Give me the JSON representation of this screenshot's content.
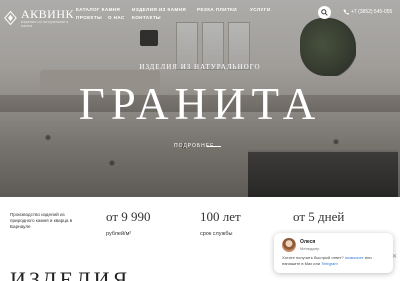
{
  "header": {
    "logo_text": "АКВИНК",
    "logo_sub": "изделия из натурального камня",
    "nav": [
      "КАТАЛОГ КАМНЯ",
      "ИЗДЕЛИЯ ИЗ КАМНЯ",
      "РЕЗКА ПЛИТКИ",
      "УСЛУГИ",
      "ПРОЕКТЫ",
      "О НАС",
      "КОНТАКТЫ"
    ],
    "phone": "+7 (3852) 545-055",
    "icons": {
      "search": "search-icon",
      "phone": "phone-icon",
      "logo": "logo-mark-icon"
    }
  },
  "hero": {
    "subtitle": "ИЗДЕЛИЯ ИЗ НАТУРАЛЬНОГО",
    "title": "ГРАНИТА",
    "more": "ПОДРОБНЕЕ"
  },
  "intro": "Производство изделий из природного камня и кварца в Барнауле",
  "stats": [
    {
      "value": "от 9 990",
      "label": "рублей/м²"
    },
    {
      "value": "100 лет",
      "label": "срок службы"
    },
    {
      "value": "от 5 дней",
      "label": "срок изготовления"
    }
  ],
  "section_heading": "ИЗДЕЛИЯ",
  "chat": {
    "name": "Олеся",
    "role": "Менеджер",
    "message_start": "Хотите получить быстрый ответ?",
    "link1": "позвоните",
    "message_mid": "или напишите в Max или",
    "link2": "Telegram",
    "close_icon": "close-icon"
  },
  "colors": {
    "accent": "#2b7bd6",
    "text": "#333333"
  }
}
